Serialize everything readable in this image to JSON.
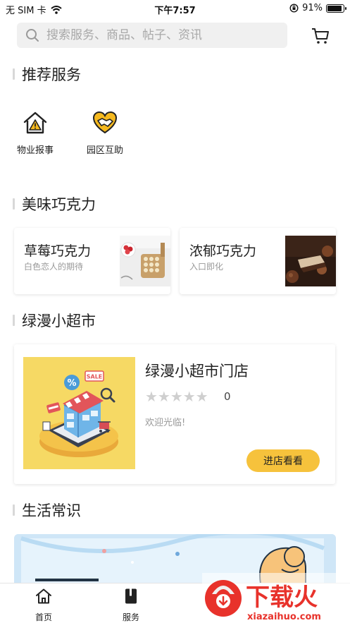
{
  "status_bar": {
    "carrier": "无 SIM 卡",
    "time": "下午7:57",
    "battery_percent": "91%",
    "battery_level": 0.91
  },
  "search": {
    "placeholder": "搜索服务、商品、帖子、资讯"
  },
  "sections": {
    "recommended": "推荐服务",
    "chocolate": "美味巧克力",
    "supermarket": "绿漫小超市",
    "life_tips": "生活常识"
  },
  "services": [
    {
      "label": "物业报事",
      "icon": "house-warning-icon"
    },
    {
      "label": "园区互助",
      "icon": "heart-handshake-icon"
    }
  ],
  "chocolates": [
    {
      "name": "草莓巧克力",
      "desc": "白色恋人的期待"
    },
    {
      "name": "浓郁巧克力",
      "desc": "入口即化"
    }
  ],
  "store": {
    "name": "绿漫小超市门店",
    "stars": "★★★★★",
    "rating": "0",
    "welcome": "欢迎光临!",
    "enter_label": "进店看看",
    "sale_tag": "SALE",
    "percent_tag": "%"
  },
  "tabs": [
    {
      "label": "首页",
      "icon": "home-icon"
    },
    {
      "label": "服务",
      "icon": "book-icon"
    }
  ],
  "watermark": {
    "text": "下载火",
    "url": "xiazaihuo.com"
  },
  "colors": {
    "accent": "#f6c23c",
    "icon_yellow": "#f5b91f",
    "watermark_red": "#e8322b"
  }
}
